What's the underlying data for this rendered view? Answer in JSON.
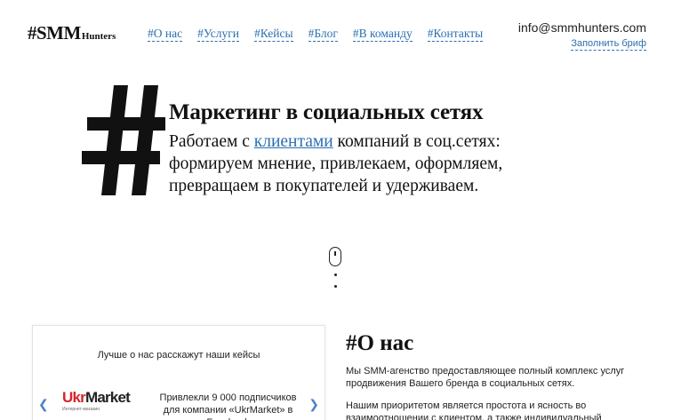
{
  "header": {
    "logo_main": "#SMM",
    "logo_sub": "Hunters",
    "nav": [
      "#О нас",
      "#Услуги",
      "#Кейсы",
      "#Блог",
      "#В команду",
      "#Контакты"
    ],
    "email": "info@smmhunters.com",
    "brief_link": "Заполнить бриф"
  },
  "hero": {
    "title": "Маркетинг в социальных сетях",
    "text_before": "Работаем с ",
    "text_link": "клиентами",
    "text_after": " компаний в соц.сетях: формируем мнение, привлекаем, оформляем, превращаем в покупателей и удерживаем."
  },
  "cases": {
    "title": "Лучше о нас расскажут наши кейсы",
    "logo_part1": "Ukr",
    "logo_part2": "Market",
    "logo_tagline": "Интернет-магазин",
    "line1": "Привлекли 9 000 подписчиков",
    "line2": "для компании «UkrMarket» в Facebook",
    "prev_arrow": "❮",
    "next_arrow": "❯"
  },
  "about": {
    "title": "#О нас",
    "p1": "Мы SMM-агенство предоставляющее полный комплекс услуг продвижения Вашего бренда в социальных сетях.",
    "p2": "Нашим приоритетом является простота и ясность во взаимоотношении с клиентом, а также индивидуальный подход к"
  },
  "colors": {
    "link": "#2a6fb0",
    "text": "#111111",
    "brand_red": "#d8232a"
  }
}
